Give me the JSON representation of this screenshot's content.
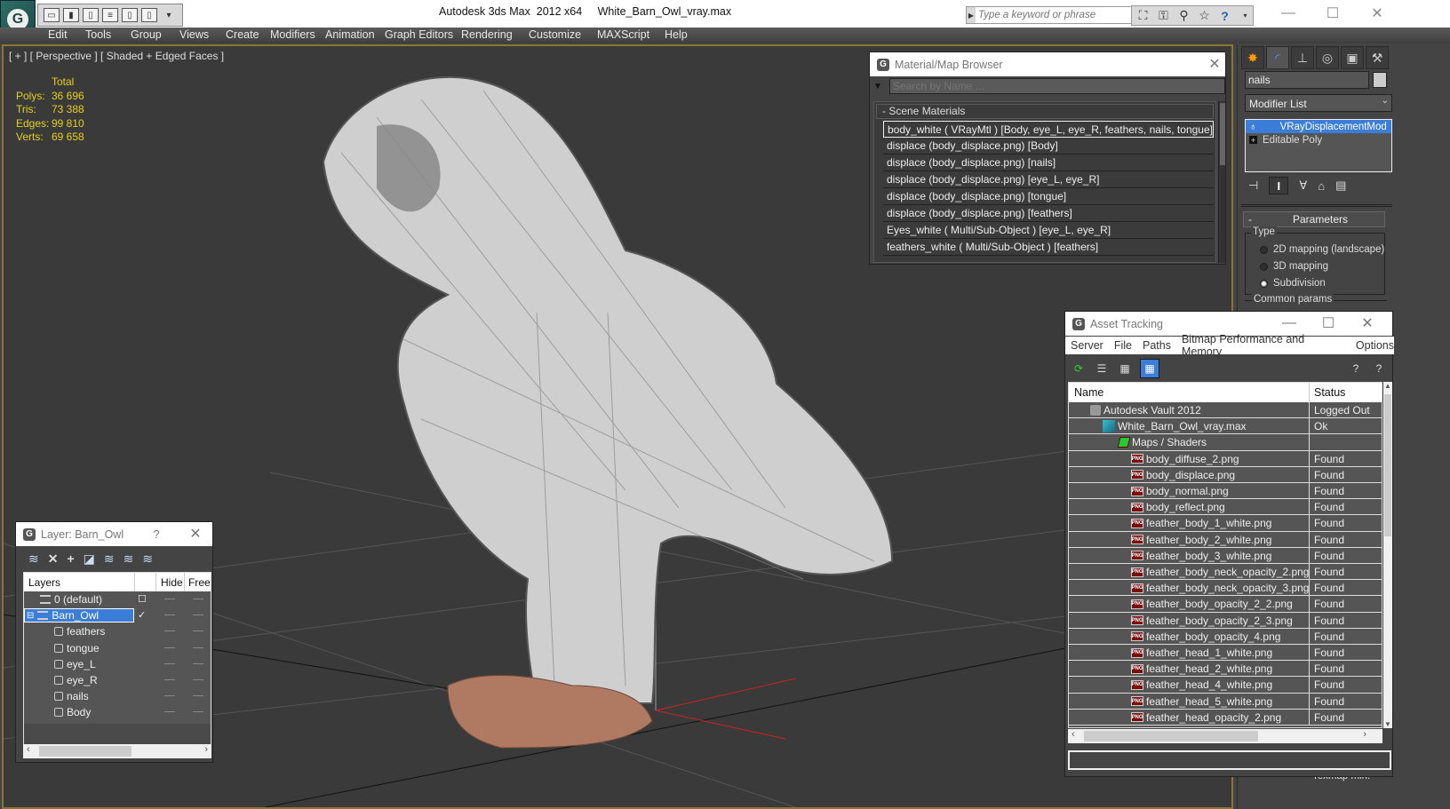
{
  "app": {
    "title": "Autodesk 3ds Max  2012 x64     White_Barn_Owl_vray.max",
    "search_placeholder": "Type a keyword or phrase",
    "icons": [
      "binoculars-icon",
      "key-icon",
      "satellite-icon",
      "star-icon",
      "help-icon"
    ]
  },
  "quick_access": [
    "open-icon",
    "save-icon",
    "new-icon",
    "project-icon",
    "hold-icon",
    "fetch-icon",
    "dropdown-icon"
  ],
  "menu": [
    "Edit",
    "Tools",
    "Group",
    "Views",
    "Create",
    "Modifiers",
    "Animation",
    "Graph Editors",
    "Rendering",
    "Customize",
    "MAXScript",
    "Help"
  ],
  "viewport": {
    "label": "[ + ] [ Perspective ] [ Shaded + Edged Faces ]",
    "stats": {
      "header": "Total",
      "rows": [
        {
          "key": "Polys:",
          "value": "36 696"
        },
        {
          "key": "Tris:",
          "value": "73 388"
        },
        {
          "key": "Edges:",
          "value": "99 810"
        },
        {
          "key": "Verts:",
          "value": "69 658"
        }
      ]
    }
  },
  "material_browser": {
    "title": "Material/Map Browser",
    "search_placeholder": "Search by Name ...",
    "section": "- Scene Materials",
    "items": [
      "body_white  ( VRayMtl )  [Body, eye_L, eye_R, feathers, nails, tongue]",
      "displace (body_displace.png) [Body]",
      "displace (body_displace.png) [nails]",
      "displace (body_displace.png) [eye_L, eye_R]",
      "displace (body_displace.png) [tongue]",
      "displace (body_displace.png) [feathers]",
      "Eyes_white  ( Multi/Sub-Object )  [eye_L, eye_R]",
      "feathers_white  ( Multi/Sub-Object )  [feathers]"
    ]
  },
  "command_panel": {
    "object_name": "nails",
    "modifier_list": "Modifier List",
    "stack": [
      "VRayDisplacementMod",
      "Editable Poly"
    ],
    "parameters_title": "Parameters",
    "type_label": "Type",
    "type_options": [
      {
        "label": "2D mapping (landscape)",
        "selected": false
      },
      {
        "label": "3D mapping",
        "selected": false
      },
      {
        "label": "Subdivision",
        "selected": true
      }
    ],
    "common_params": "Common params",
    "texmap_min": "Texmap min:"
  },
  "asset_tracking": {
    "title": "Asset Tracking",
    "menu": [
      "Server",
      "File",
      "Paths",
      "Bitmap Performance and Memory",
      "Options"
    ],
    "columns": [
      "Name",
      "Status"
    ],
    "rows": [
      {
        "name": "Autodesk Vault 2012",
        "status": "Logged Out",
        "level": 0,
        "icon": "vault"
      },
      {
        "name": "White_Barn_Owl_vray.max",
        "status": "Ok",
        "level": 1,
        "icon": "max"
      },
      {
        "name": "Maps / Shaders",
        "status": "",
        "level": 2,
        "icon": "maps"
      },
      {
        "name": "body_diffuse_2.png",
        "status": "Found",
        "level": 3,
        "icon": "png"
      },
      {
        "name": "body_displace.png",
        "status": "Found",
        "level": 3,
        "icon": "png"
      },
      {
        "name": "body_normal.png",
        "status": "Found",
        "level": 3,
        "icon": "png"
      },
      {
        "name": "body_reflect.png",
        "status": "Found",
        "level": 3,
        "icon": "png"
      },
      {
        "name": "feather_body_1_white.png",
        "status": "Found",
        "level": 3,
        "icon": "png"
      },
      {
        "name": "feather_body_2_white.png",
        "status": "Found",
        "level": 3,
        "icon": "png"
      },
      {
        "name": "feather_body_3_white.png",
        "status": "Found",
        "level": 3,
        "icon": "png"
      },
      {
        "name": "feather_body_neck_opacity_2.png",
        "status": "Found",
        "level": 3,
        "icon": "png"
      },
      {
        "name": "feather_body_neck_opacity_3.png",
        "status": "Found",
        "level": 3,
        "icon": "png"
      },
      {
        "name": "feather_body_opacity_2_2.png",
        "status": "Found",
        "level": 3,
        "icon": "png"
      },
      {
        "name": "feather_body_opacity_2_3.png",
        "status": "Found",
        "level": 3,
        "icon": "png"
      },
      {
        "name": "feather_body_opacity_4.png",
        "status": "Found",
        "level": 3,
        "icon": "png"
      },
      {
        "name": "feather_head_1_white.png",
        "status": "Found",
        "level": 3,
        "icon": "png"
      },
      {
        "name": "feather_head_2_white.png",
        "status": "Found",
        "level": 3,
        "icon": "png"
      },
      {
        "name": "feather_head_4_white.png",
        "status": "Found",
        "level": 3,
        "icon": "png"
      },
      {
        "name": "feather_head_5_white.png",
        "status": "Found",
        "level": 3,
        "icon": "png"
      },
      {
        "name": "feather_head_opacity_2.png",
        "status": "Found",
        "level": 3,
        "icon": "png"
      }
    ],
    "png_label": "PNG"
  },
  "layer_dialog": {
    "title": "Layer: Barn_Owl",
    "help": "?",
    "columns": [
      "Layers",
      "Hide",
      "Freeze"
    ],
    "rows": [
      {
        "name": "0 (default)",
        "type": "layer",
        "level": 0,
        "selected": false,
        "current": false
      },
      {
        "name": "Barn_Owl",
        "type": "layer",
        "level": 0,
        "selected": true,
        "current": true
      },
      {
        "name": "feathers",
        "type": "object",
        "level": 1
      },
      {
        "name": "tongue",
        "type": "object",
        "level": 1
      },
      {
        "name": "eye_L",
        "type": "object",
        "level": 1
      },
      {
        "name": "eye_R",
        "type": "object",
        "level": 1
      },
      {
        "name": "nails",
        "type": "object",
        "level": 1
      },
      {
        "name": "Body",
        "type": "object",
        "level": 1
      }
    ]
  },
  "colors": {
    "viewport_bg": "#3a3a3a",
    "viewport_border": "#8a7532",
    "stats_text": "#e4d218",
    "selection": "#3b7ed9",
    "png_icon": "#7a0d0d"
  }
}
